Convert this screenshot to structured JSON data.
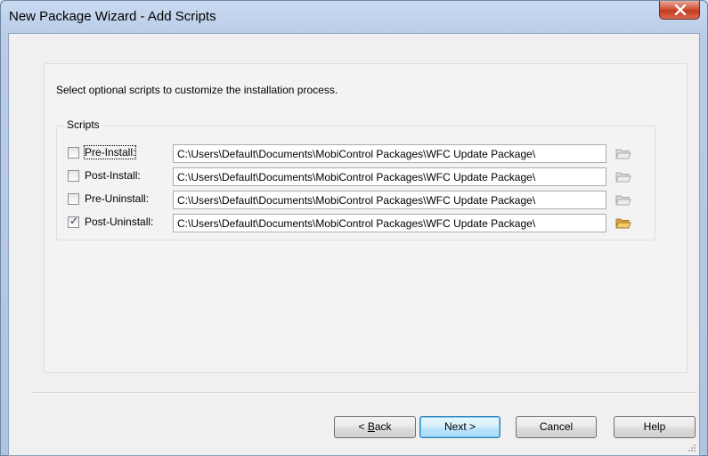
{
  "window": {
    "title": "New Package Wizard - Add Scripts",
    "close_glyph": "x"
  },
  "instruction": "Select optional scripts to customize the installation process.",
  "scripts": {
    "group_label": "Scripts",
    "rows": [
      {
        "label": "Pre-Install:",
        "checked": false,
        "path": "C:\\Users\\Default\\Documents\\MobiControl Packages\\WFC Update Package\\",
        "folder_icon": "folder-open-icon-disabled"
      },
      {
        "label": "Post-Install:",
        "checked": false,
        "path": "C:\\Users\\Default\\Documents\\MobiControl Packages\\WFC Update Package\\",
        "folder_icon": "folder-open-icon-disabled"
      },
      {
        "label": "Pre-Uninstall:",
        "checked": false,
        "path": "C:\\Users\\Default\\Documents\\MobiControl Packages\\WFC Update Package\\",
        "folder_icon": "folder-open-icon-disabled"
      },
      {
        "label": "Post-Uninstall:",
        "checked": true,
        "path": "C:\\Users\\Default\\Documents\\MobiControl Packages\\WFC Update Package\\",
        "folder_icon": "folder-open-icon"
      }
    ]
  },
  "buttons": {
    "back": "< Back",
    "next": "Next >",
    "cancel": "Cancel",
    "help": "Help"
  },
  "colors": {
    "title_bar": "#b9cde8",
    "close_button": "#c43b23",
    "default_button_border": "#3c7fb1",
    "folder_enabled": "#e8b84a",
    "folder_disabled": "#c9c9c9"
  }
}
